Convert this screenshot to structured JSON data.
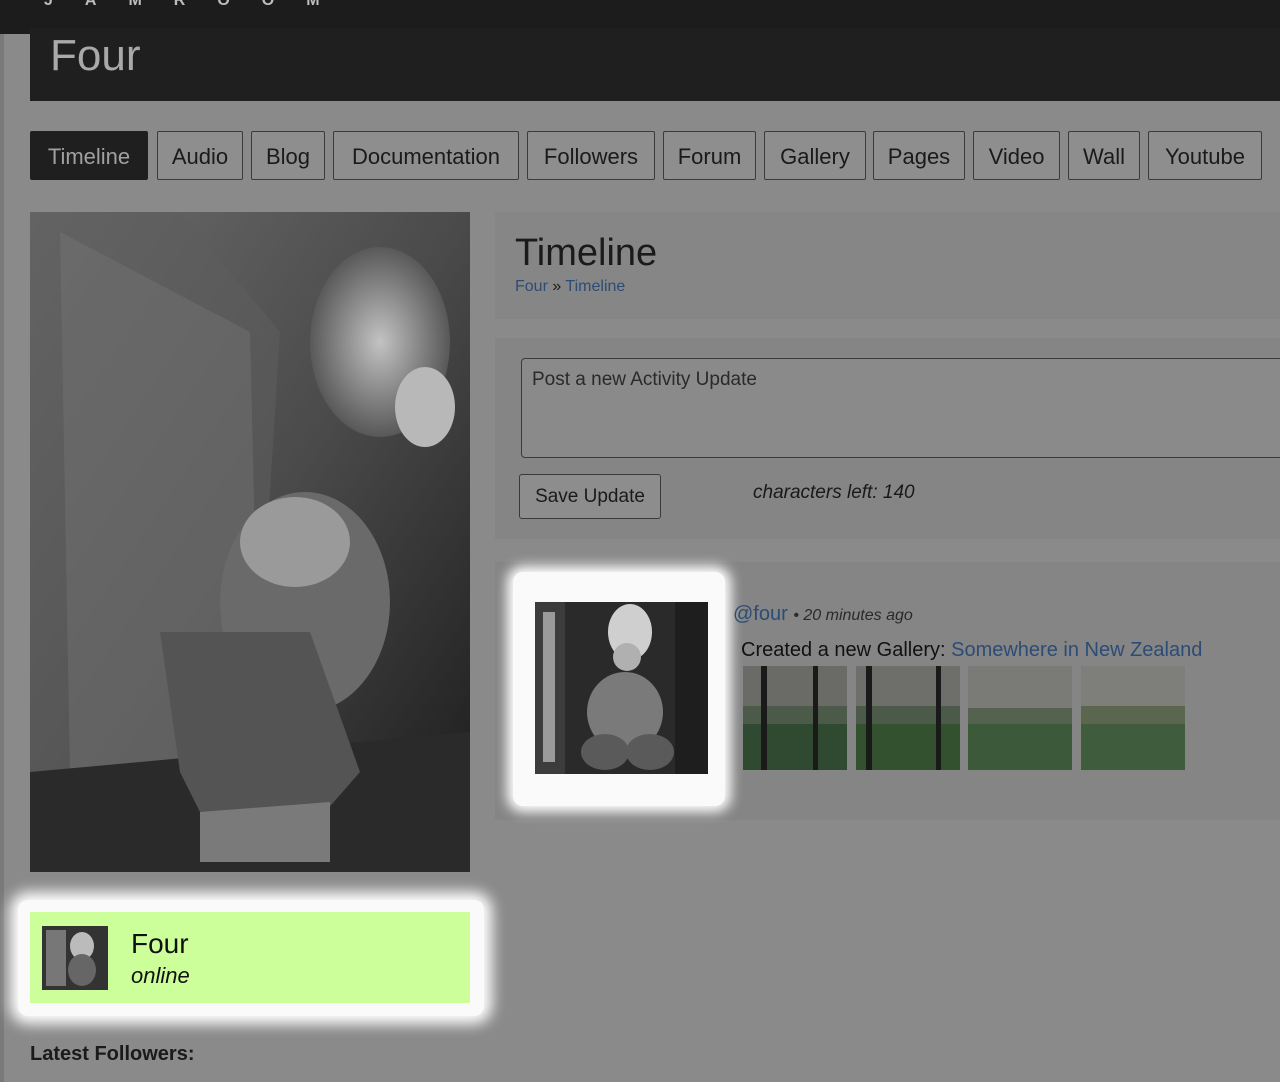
{
  "brand": {
    "logo_text": "JAMROOM"
  },
  "profile": {
    "name": "Four"
  },
  "tabs": [
    {
      "label": "Timeline",
      "active": true
    },
    {
      "label": "Audio"
    },
    {
      "label": "Blog"
    },
    {
      "label": "Documentation"
    },
    {
      "label": "Followers"
    },
    {
      "label": "Forum"
    },
    {
      "label": "Gallery"
    },
    {
      "label": "Pages"
    },
    {
      "label": "Video"
    },
    {
      "label": "Wall"
    },
    {
      "label": "Youtube"
    }
  ],
  "page": {
    "title": "Timeline",
    "breadcrumb": {
      "first": "Four",
      "separator": "»",
      "current": "Timeline"
    }
  },
  "update": {
    "placeholder": "Post a new Activity Update",
    "save_label": "Save Update",
    "chars_left": "characters left: 140"
  },
  "activity": {
    "user": "@four",
    "time": "• 20 minutes ago",
    "prefix": "Created a new Gallery:",
    "gallery_name": "Somewhere in New Zealand"
  },
  "online": {
    "name": "Four",
    "status": "online"
  },
  "sidebar": {
    "latest_followers": "Latest Followers:"
  },
  "colors": {
    "online_bg": "#ccff99",
    "link": "#2c4c75",
    "header_bg": "#1f1f1f"
  }
}
